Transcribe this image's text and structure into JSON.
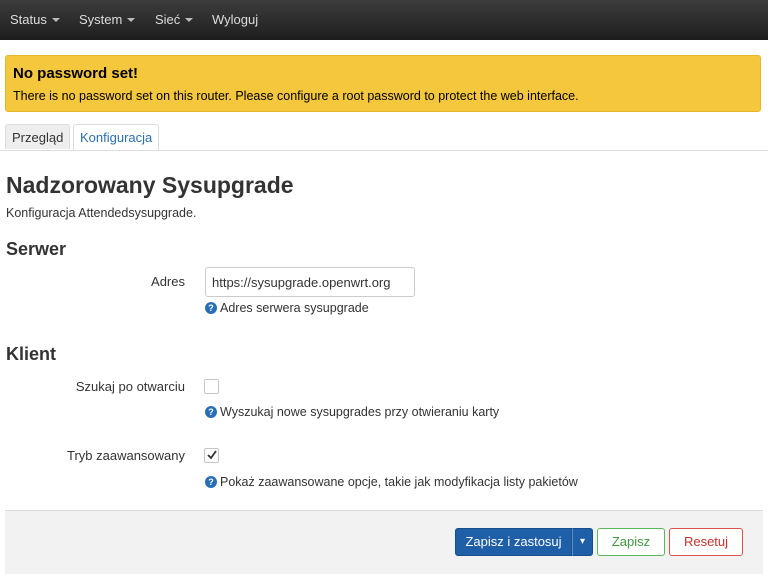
{
  "nav": {
    "items": [
      {
        "label": "Status",
        "has_caret": true
      },
      {
        "label": "System",
        "has_caret": true
      },
      {
        "label": "Sieć",
        "has_caret": true
      },
      {
        "label": "Wyloguj",
        "has_caret": false
      }
    ]
  },
  "alert": {
    "title": "No password set!",
    "text": "There is no password set on this router. Please configure a root password to protect the web interface.",
    "color": "#f5c73d"
  },
  "tabs": [
    {
      "label": "Przegląd",
      "active": false
    },
    {
      "label": "Konfiguracja",
      "active": true
    }
  ],
  "page": {
    "title": "Nadzorowany Sysupgrade",
    "description": "Konfiguracja Attendedsysupgrade."
  },
  "server": {
    "section_title": "Serwer",
    "address_label": "Adres",
    "address_value": "https://sysupgrade.openwrt.org",
    "address_help": "Adres serwera sysupgrade"
  },
  "client": {
    "section_title": "Klient",
    "search_label": "Szukaj po otwarciu",
    "search_checked": false,
    "search_help": "Wyszukaj nowe sysupgrades przy otwieraniu karty",
    "advanced_label": "Tryb zaawansowany",
    "advanced_checked": true,
    "advanced_help": "Pokaż zaawansowane opcje, takie jak modyfikacja listy pakietów"
  },
  "actions": {
    "save_apply_label": "Zapisz i zastosuj",
    "dropdown_glyph": "▾",
    "save_label": "Zapisz",
    "reset_label": "Resetuj"
  },
  "colors": {
    "accent": "#2a6fb5",
    "primary_button": "#1f5fa8",
    "save_border": "#5cb85c",
    "reset_border": "#d9534f"
  }
}
